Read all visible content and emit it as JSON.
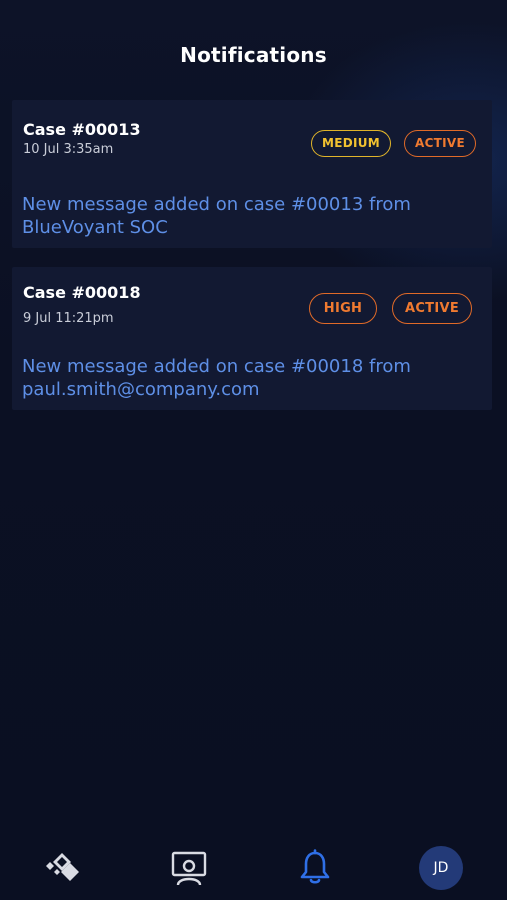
{
  "header": {
    "title": "Notifications"
  },
  "notifications": [
    {
      "case_word": "Case",
      "case_number": "#00013",
      "date": "10 Jul 3:35am",
      "badges": [
        "MEDIUM",
        "ACTIVE"
      ],
      "message": "New message added on case #00013 from BlueVoyant SOC"
    },
    {
      "case_word": "Case",
      "case_number": "#00018",
      "date": "9 Jul 11:21pm",
      "badges": [
        "HIGH",
        "ACTIVE"
      ],
      "message": "New message added on case #00018 from paul.smith@company.com"
    }
  ],
  "tabbar": {
    "items": [
      {
        "icon": "logo-diamond-icon",
        "active": false
      },
      {
        "icon": "monitor-user-icon",
        "active": false
      },
      {
        "icon": "bell-icon",
        "active": true
      },
      {
        "icon": "avatar",
        "active": false
      }
    ],
    "avatar_initials": "JD"
  },
  "colors": {
    "background": "#0c1124",
    "card": "#121932",
    "message_link": "#5e8fe6",
    "badge_medium": "#f2c230",
    "badge_high_active": "#f07a30",
    "active_tab": "#2f6fe6",
    "avatar_bg": "#233a78"
  }
}
